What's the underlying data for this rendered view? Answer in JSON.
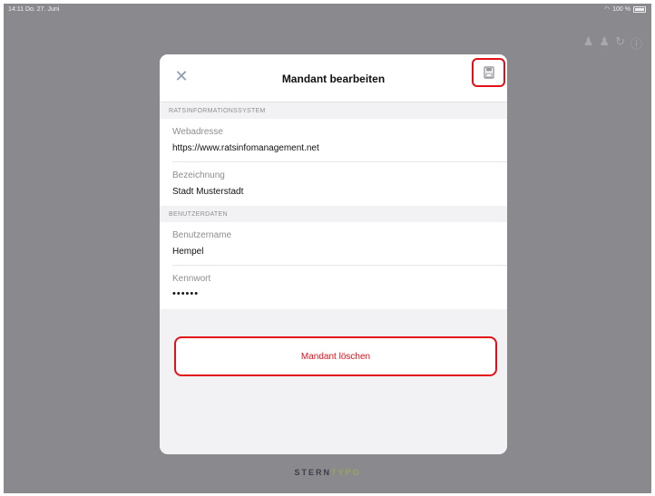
{
  "status_bar": {
    "time": "14:11  Do. 27. Juni",
    "battery": "100 %"
  },
  "background": {
    "toolbar_icons": [
      "person-icon",
      "person-icon",
      "refresh-icon",
      "info-icon"
    ],
    "logo_main": "STERN",
    "logo_accent": "TYPO"
  },
  "modal": {
    "title": "Mandant bearbeiten",
    "close_icon": "close-icon",
    "save_icon": "save-icon",
    "sections": {
      "system": {
        "header": "RATSINFORMATIONSSYSTEM",
        "fields": [
          {
            "label": "Webadresse",
            "value": "https://www.ratsinfomanagement.net"
          },
          {
            "label": "Bezeichnung",
            "value": "Stadt Musterstadt"
          }
        ]
      },
      "user": {
        "header": "BENUTZERDATEN",
        "fields": [
          {
            "label": "Benutzername",
            "value": "Hempel"
          },
          {
            "label": "Kennwort",
            "value": "••••••"
          }
        ]
      }
    },
    "delete_label": "Mandant löschen"
  },
  "colors": {
    "accent_red": "#e3101a",
    "backdrop": "#8a8a8e"
  }
}
